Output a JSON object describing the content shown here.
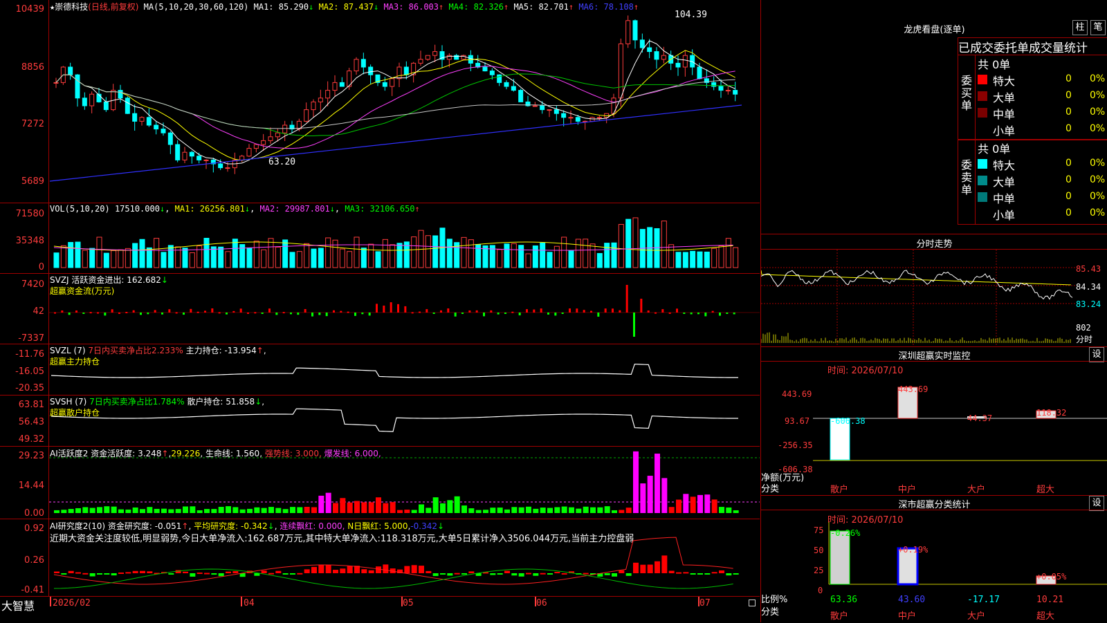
{
  "main": {
    "header": {
      "star": "★",
      "name": "崇德科技",
      "mode": "(日线,前复权)",
      "ma_def": "MA(5,10,20,30,60,120)",
      "ma1": "MA1: 85.290",
      "ma1a": "↓",
      "ma2": "MA2: 87.437",
      "ma2a": "↓",
      "ma3": "MA3: 86.003",
      "ma3a": "↑",
      "ma4": "MA4: 82.326",
      "ma4a": "↑",
      "ma5": "MA5: 82.701",
      "ma5a": "↑",
      "ma6": "MA6: 78.108",
      "ma6a": "↑"
    },
    "ticks": [
      "10439",
      "8856",
      "7272",
      "5689"
    ],
    "high_label": "104.39",
    "low_label": "63.20"
  },
  "vol": {
    "header": {
      "name": "VOL(5,10,20)",
      "val": "17510.000",
      "a0": "↓",
      "ma1": "MA1: 26256.801",
      "a1": "↓",
      "ma2": "MA2: 29987.801",
      "a2": "↓",
      "ma3": "MA3: 32106.650",
      "a3": "↑"
    },
    "ticks": [
      "71580",
      "35348",
      "0"
    ]
  },
  "svzj": {
    "header": {
      "name": "SVZJ",
      "label": "活跃资金进出: 162.682",
      "a": "↓",
      "sub": "超赢资金流(万元)"
    },
    "ticks": [
      "7420",
      "42",
      "-7337"
    ]
  },
  "svzl": {
    "header": {
      "name": "SVZL (7)",
      "p1": "7日内买卖净占比2.233%",
      "p2": "主力持仓: -13.954",
      "a": "↑",
      "sub": "超赢主力持仓"
    },
    "ticks": [
      "-11.76",
      "-16.05",
      "-20.35"
    ]
  },
  "svsh": {
    "header": {
      "name": "SVSH (7)",
      "p1": "7日内买卖净占比1.784%",
      "p2": "散户持仓: 51.858",
      "a": "↓",
      "sub": "超赢散户持仓"
    },
    "ticks": [
      "63.81",
      "56.43",
      "49.32"
    ]
  },
  "ai2": {
    "header": {
      "name": "AI活跃度2",
      "p1": "资金活跃度: 3.248",
      "a1": "↑",
      "p2": "29.226",
      "p3": "生命线: 1.560",
      "p4": "强势线: 3.000",
      "p5": "爆发线: 6.000"
    },
    "ticks": [
      "29.23",
      "14.44",
      "0.00"
    ]
  },
  "ai3": {
    "header": {
      "name": "AI研究度2(10)",
      "p1": "资金研究度: -0.051",
      "a1": "↑",
      "p2": "平均研究度: -0.342",
      "a2": "↓",
      "p3": "连续飘红: 0.000",
      "p4": "N日飘红: 5.000",
      "p5": "-0.342",
      "a5": "↓"
    },
    "comment": "近期大资金关注度较低,明显弱势,今日大单净流入:162.687万元,其中特大单净流入:118.318万元,大单5日累计净入3506.044万元,当前主力控盘弱",
    "ticks": [
      "0.92",
      "0.26",
      "-0.41"
    ]
  },
  "xaxis": {
    "brand": "大智慧",
    "labels": [
      "2026/02",
      "04",
      "05",
      "06",
      "07"
    ]
  },
  "right": {
    "lhb_title": "龙虎看盘(逐单)",
    "btn_bar": "柱",
    "btn_pen": "笔",
    "tabs": "已成交委托单成交量统计",
    "buy": {
      "side": "委买单",
      "total": "共 0单",
      "rows": [
        {
          "name": "特大",
          "v": "0",
          "p": "0%"
        },
        {
          "name": "大单",
          "v": "0",
          "p": "0%"
        },
        {
          "name": "中单",
          "v": "0",
          "p": "0%"
        },
        {
          "name": "小单",
          "v": "0",
          "p": "0%"
        }
      ]
    },
    "sell": {
      "side": "委卖单",
      "total": "共 0单",
      "rows": [
        {
          "name": "特大",
          "v": "0",
          "p": "0%"
        },
        {
          "name": "大单",
          "v": "0",
          "p": "0%"
        },
        {
          "name": "中单",
          "v": "0",
          "p": "0%"
        },
        {
          "name": "小单",
          "v": "0",
          "p": "0%"
        }
      ]
    },
    "intraday": {
      "title": "分时走势",
      "ticks": [
        "85.43",
        "84.34",
        "83.24",
        "802"
      ],
      "vol_lbl": "分时"
    },
    "sz_monitor": {
      "title": "深圳超赢实时监控",
      "btn": "设",
      "time": "时间: 2026/07/10",
      "ticks": [
        "443.69",
        "93.67",
        "-256.35",
        "-606.38"
      ],
      "ylabel": "净额(万元)",
      "xlabel": "分类",
      "cats": [
        "散户",
        "中户",
        "大户",
        "超大"
      ],
      "vals": [
        "-606.38",
        "443.69",
        "44.37",
        "118.32"
      ]
    },
    "sz_class": {
      "title": "深市超赢分类统计",
      "btn": "设",
      "time": "时间: 2026/07/10",
      "ticks": [
        "75",
        "50",
        "25",
        "0"
      ],
      "ylabel": "比例%",
      "xlabel": "分类",
      "cats": [
        "散户",
        "中户",
        "大户",
        "超大"
      ],
      "pct_top": [
        "-0.26%",
        "+0.19%",
        "",
        "+0.05%"
      ],
      "pct_bot": [
        "63.36",
        "43.60",
        "-17.17",
        "10.21"
      ]
    }
  }
}
